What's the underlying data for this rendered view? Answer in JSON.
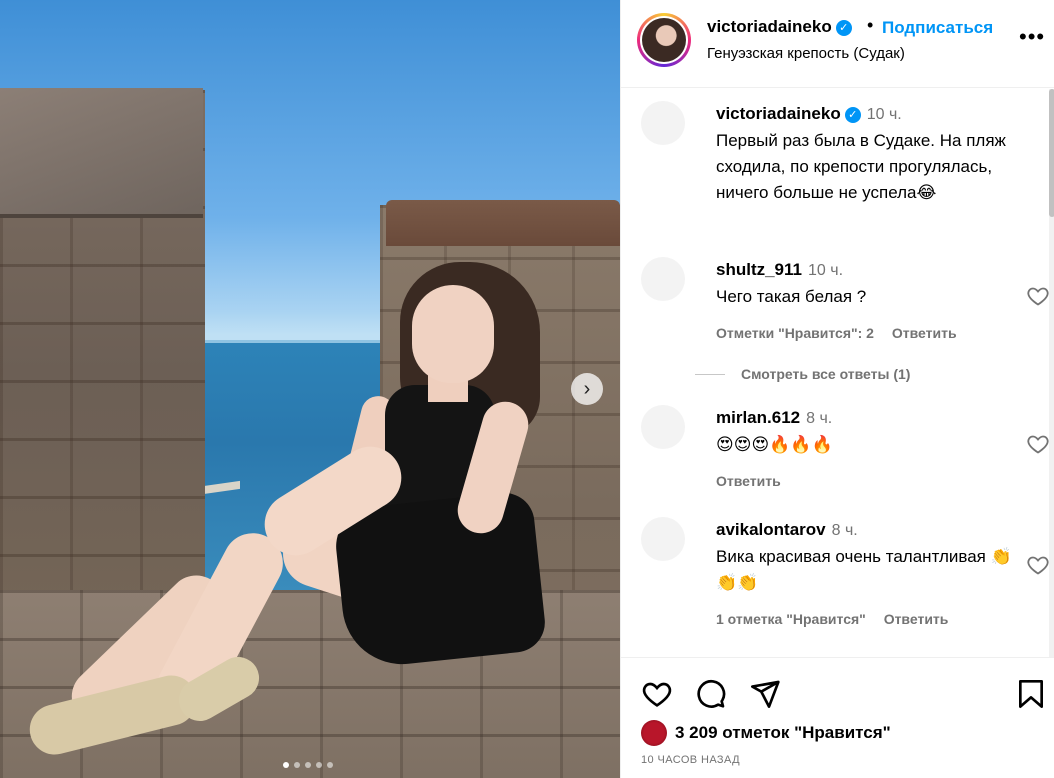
{
  "header": {
    "username": "victoriadaineko",
    "bullet": "•",
    "follow_label": "Подписаться",
    "location": "Генуэзская крепость (Судак)",
    "more_label": "•••"
  },
  "caption": {
    "username": "victoriadaineko",
    "time": "10 ч.",
    "text": "Первый раз была в Судаке. На пляж сходила, по крепости прогулялась, ничего больше не успела😂"
  },
  "comments": [
    {
      "username": "shultz_911",
      "time": "10 ч.",
      "text": "Чего такая белая ?",
      "likes_label": "Отметки \"Нравится\": 2",
      "reply_label": "Ответить"
    },
    {
      "username": "mirlan.612",
      "time": "8 ч.",
      "text": "😍😍😍🔥🔥🔥",
      "likes_label": "",
      "reply_label": "Ответить"
    },
    {
      "username": "avikalontarov",
      "time": "8 ч.",
      "text": "Вика красивая очень талантливая 👏👏👏",
      "likes_label": "1 отметка \"Нравится\"",
      "reply_label": "Ответить"
    }
  ],
  "view_replies_label": "Смотреть все ответы (1)",
  "actions": {
    "like_icon": "heart-outline-icon",
    "comment_icon": "comment-bubble-icon",
    "share_icon": "paper-plane-icon",
    "save_icon": "bookmark-icon"
  },
  "likes_text": "3 209 отметок \"Нравится\"",
  "time_ago": "10 ЧАСОВ НАЗАД",
  "media": {
    "next_glyph": "›",
    "slide_count": 5,
    "active_slide": 0
  },
  "colors": {
    "accent": "#0095f6",
    "muted": "#737373"
  }
}
